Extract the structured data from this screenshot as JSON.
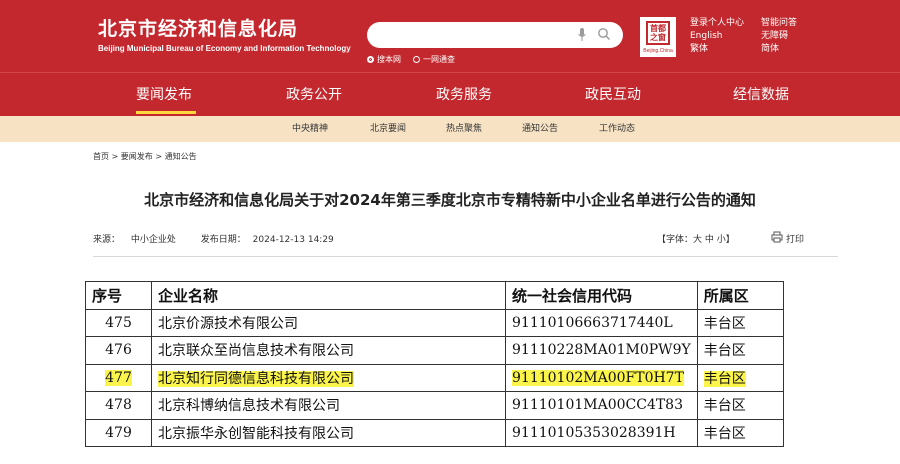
{
  "header": {
    "site_title": "北京市经济和信息化局",
    "site_subtitle": "Beijing Municipal Bureau of Economy and Information Technology",
    "search_placeholder": "",
    "scopes": [
      "搜本网",
      "一网通查"
    ],
    "capital_logo": {
      "mark": "首都之窗",
      "text": "Beijing.China"
    },
    "links_col1": [
      "登录个人中心",
      "English",
      "繁体"
    ],
    "links_col2": [
      "智能问答",
      "无障碍",
      "简体"
    ]
  },
  "nav": {
    "items": [
      "要闻发布",
      "政务公开",
      "政务服务",
      "政民互动",
      "经信数据"
    ],
    "active_index": 0
  },
  "subnav": {
    "items": [
      "中央精神",
      "北京要闻",
      "热点聚焦",
      "通知公告",
      "工作动态"
    ]
  },
  "breadcrumb": "首页 > 要闻发布 > 通知公告",
  "article": {
    "title": "北京市经济和信息化局关于对2024年第三季度北京市专精特新中小企业名单进行公告的通知",
    "source_label": "来源：",
    "source_value": "中小企业处",
    "date_label": "发布日期：",
    "date_value": "2024-12-13 14:29",
    "font_size_label": "【字体：大 中 小】",
    "print_label": "打印"
  },
  "table": {
    "headers": [
      "序号",
      "企业名称",
      "统一社会信用代码",
      "所属区"
    ],
    "rows": [
      [
        "475",
        "北京价源技术有限公司",
        "91110106663717440L",
        "丰台区"
      ],
      [
        "476",
        "北京联众至尚信息技术有限公司",
        "91110228MA01M0PW9Y",
        "丰台区"
      ],
      [
        "477",
        "北京知行同德信息科技有限公司",
        "91110102MA00FT0H7T",
        "丰台区"
      ],
      [
        "478",
        "北京科博纳信息技术有限公司",
        "91110101MA00CC4T83",
        "丰台区"
      ],
      [
        "479",
        "北京振华永创智能科技有限公司",
        "91110105353028391H",
        "丰台区"
      ]
    ],
    "highlighted_row_index": 2,
    "highlight_color": "#fbf44a"
  },
  "colors": {
    "brand_red": "#c3282e",
    "subnav_bg": "#f7e3c4",
    "nav_active_underline": "#ffd93d"
  }
}
